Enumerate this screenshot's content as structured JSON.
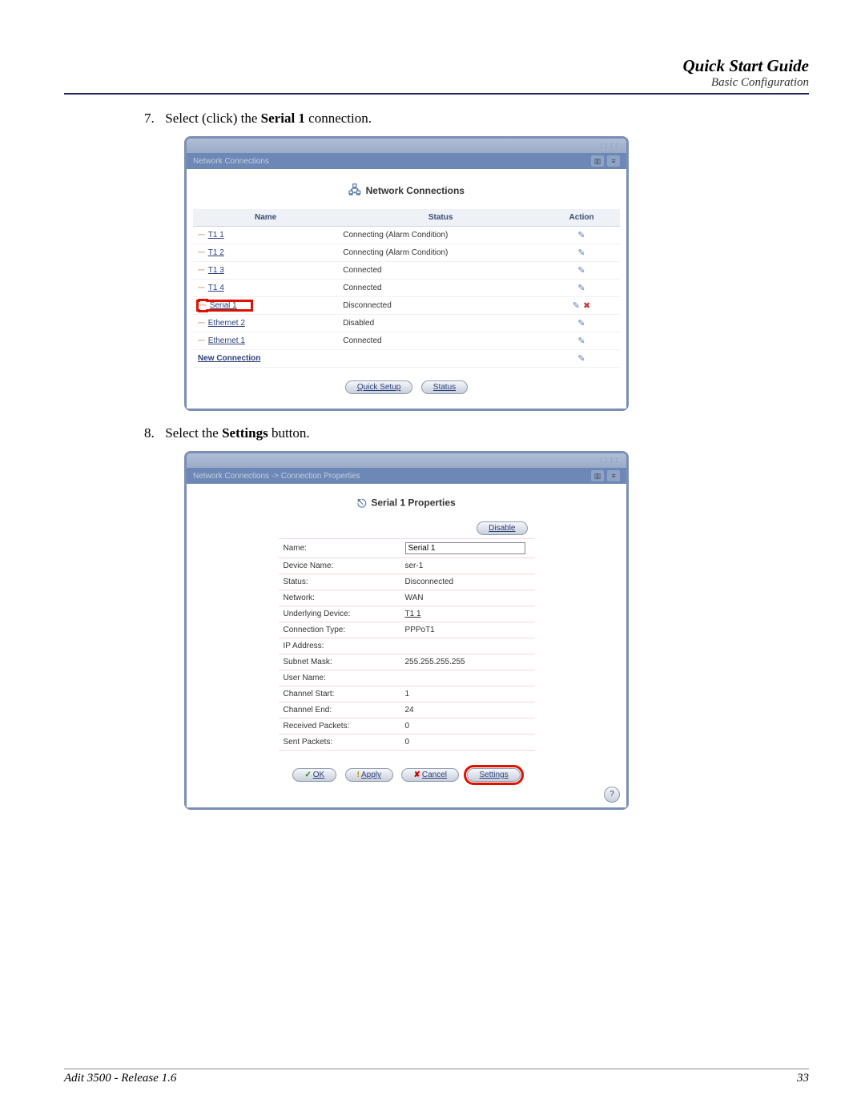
{
  "header": {
    "title": "Quick Start Guide",
    "subtitle": "Basic Configuration"
  },
  "steps": {
    "s7": {
      "num": "7.",
      "pre": "Select (click) the ",
      "bold": "Serial 1",
      "post": " connection."
    },
    "s8": {
      "num": "8.",
      "pre": "Select the ",
      "bold": "Settings",
      "post": " button."
    }
  },
  "panel1": {
    "breadcrumb": "Network Connections",
    "title": "Network Connections",
    "cols": {
      "name": "Name",
      "status": "Status",
      "action": "Action"
    },
    "rows": [
      {
        "name": "T1 1",
        "status": "Connecting (Alarm Condition)",
        "cls": "",
        "del": false,
        "hl": false
      },
      {
        "name": "T1 2",
        "status": "Connecting (Alarm Condition)",
        "cls": "",
        "del": false,
        "hl": false
      },
      {
        "name": "T1 3",
        "status": "Connected",
        "cls": "status-green",
        "del": false,
        "hl": false
      },
      {
        "name": "T1 4",
        "status": "Connected",
        "cls": "status-green",
        "del": false,
        "hl": false
      },
      {
        "name": "Serial 1",
        "status": "Disconnected",
        "cls": "",
        "del": true,
        "hl": true
      },
      {
        "name": "Ethernet 2",
        "status": "Disabled",
        "cls": "",
        "del": false,
        "hl": false
      },
      {
        "name": "Ethernet 1",
        "status": "Connected",
        "cls": "status-green",
        "del": false,
        "hl": false
      }
    ],
    "new_connection": "New Connection",
    "buttons": {
      "quick_setup": "Quick Setup",
      "status": "Status"
    }
  },
  "panel2": {
    "breadcrumb": "Network Connections -> Connection Properties",
    "title": "Serial 1 Properties",
    "disable": "Disable",
    "fields": {
      "name_lbl": "Name:",
      "name_val": "Serial 1",
      "device_lbl": "Device Name:",
      "device_val": "ser-1",
      "status_lbl": "Status:",
      "status_val": "Disconnected",
      "network_lbl": "Network:",
      "network_val": "WAN",
      "underlying_lbl": "Underlying Device:",
      "underlying_val": "T1 1",
      "conntype_lbl": "Connection Type:",
      "conntype_val": "PPPoT1",
      "ip_lbl": "IP Address:",
      "ip_val": "",
      "subnet_lbl": "Subnet Mask:",
      "subnet_val": "255.255.255.255",
      "user_lbl": "User Name:",
      "user_val": "",
      "chstart_lbl": "Channel Start:",
      "chstart_val": "1",
      "chend_lbl": "Channel End:",
      "chend_val": "24",
      "recv_lbl": "Received Packets:",
      "recv_val": "0",
      "sent_lbl": "Sent Packets:",
      "sent_val": "0"
    },
    "buttons": {
      "ok": "OK",
      "apply": "Apply",
      "cancel": "Cancel",
      "settings": "Settings"
    },
    "help": "?"
  },
  "footer": {
    "left": "Adit 3500  - Release 1.6",
    "right": "33"
  }
}
